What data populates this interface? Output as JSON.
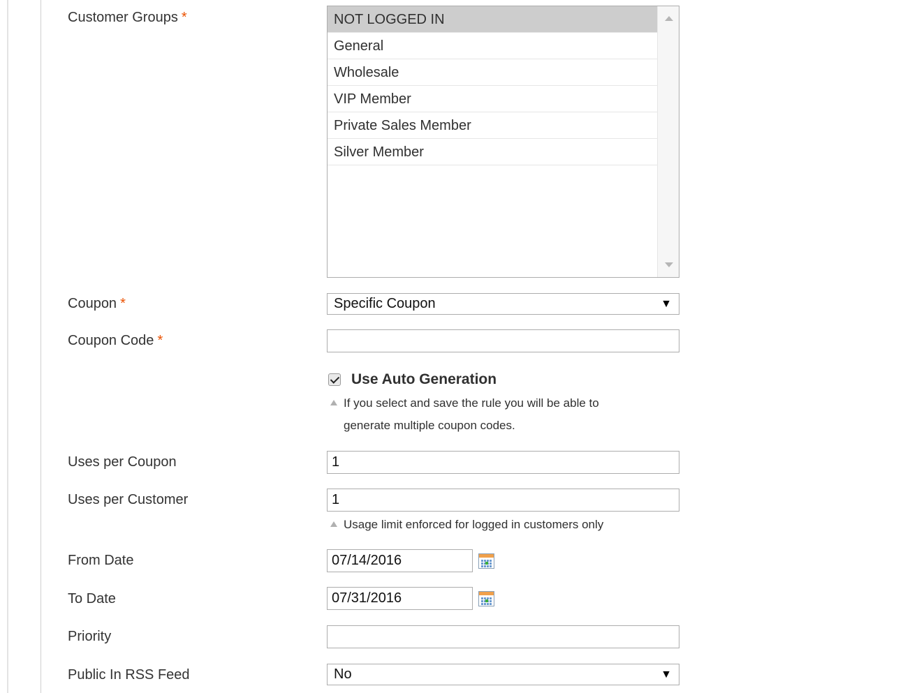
{
  "fields": {
    "customer_groups": {
      "label": "Customer Groups",
      "required_mark": "*",
      "options": [
        {
          "label": "NOT LOGGED IN",
          "selected": true
        },
        {
          "label": "General",
          "selected": false
        },
        {
          "label": "Wholesale",
          "selected": false
        },
        {
          "label": "VIP Member",
          "selected": false
        },
        {
          "label": "Private Sales Member",
          "selected": false
        },
        {
          "label": "Silver Member",
          "selected": false
        }
      ]
    },
    "coupon": {
      "label": "Coupon",
      "required_mark": "*",
      "value": "Specific Coupon",
      "caret": "▼"
    },
    "coupon_code": {
      "label": "Coupon Code",
      "required_mark": "*",
      "value": "",
      "auto_generation": {
        "label": "Use Auto Generation",
        "checked": true,
        "note_line1": "If you select and save the rule you will be able to",
        "note_line2": "generate multiple coupon codes."
      }
    },
    "uses_per_coupon": {
      "label": "Uses per Coupon",
      "value": "1"
    },
    "uses_per_customer": {
      "label": "Uses per Customer",
      "value": "1",
      "note": "Usage limit enforced for logged in customers only"
    },
    "from_date": {
      "label": "From Date",
      "value": "07/14/2016",
      "icon": "calendar-icon"
    },
    "to_date": {
      "label": "To Date",
      "value": "07/31/2016",
      "icon": "calendar-icon"
    },
    "priority": {
      "label": "Priority",
      "value": ""
    },
    "public_in_rss_feed": {
      "label": "Public In RSS Feed",
      "value": "No",
      "caret": "▼"
    }
  },
  "colors": {
    "required": "#eb5202",
    "selected_option": "#cdcdcd",
    "border": "#adadad"
  }
}
